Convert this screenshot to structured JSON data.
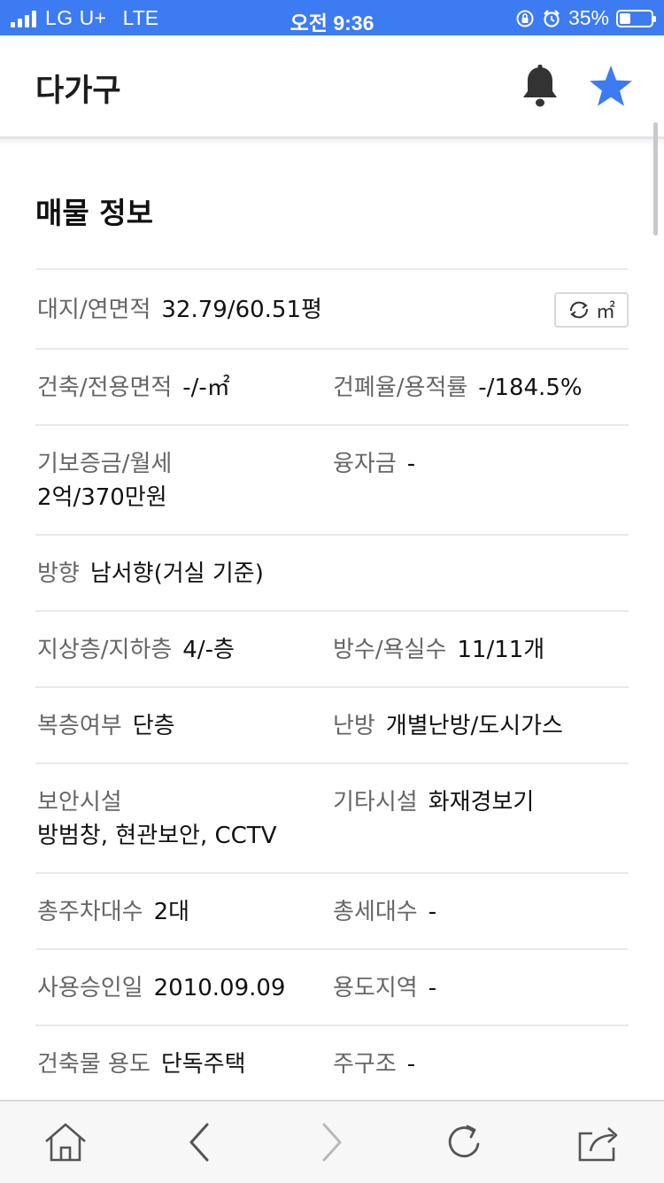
{
  "status_bar": {
    "carrier": "LG U+",
    "network": "LTE",
    "time": "오전 9:36",
    "battery_percent": "35%",
    "battery_level": 0.35
  },
  "header": {
    "title": "다가구",
    "icons": [
      "bell-icon",
      "star-icon"
    ],
    "star_color": "#3d7bf2",
    "bell_color": "#333333"
  },
  "section": {
    "title": "매물 정보"
  },
  "unit_toggle": {
    "label": "㎡",
    "icon": "refresh-icon"
  },
  "rows": [
    {
      "left": {
        "label": "대지/연면적",
        "value": "32.79/60.51평"
      }
    },
    {
      "left": {
        "label": "건축/전용면적",
        "value": "-/-㎡"
      },
      "right": {
        "label": "건폐율/용적률",
        "value": "-/184.5%"
      }
    },
    {
      "left": {
        "label": "기보증금/월세",
        "value": "2억/370만원"
      },
      "right": {
        "label": "융자금",
        "value": "-"
      }
    },
    {
      "left": {
        "label": "방향",
        "value": "남서향(거실 기준)"
      }
    },
    {
      "left": {
        "label": "지상층/지하층",
        "value": "4/-층"
      },
      "right": {
        "label": "방수/욕실수",
        "value": "11/11개"
      }
    },
    {
      "left": {
        "label": "복층여부",
        "value": "단층"
      },
      "right": {
        "label": "난방",
        "value": "개별난방/도시가스"
      }
    },
    {
      "left": {
        "label": "보안시설",
        "value": "방범창, 현관보안, CCTV"
      },
      "right": {
        "label": "기타시설",
        "value": "화재경보기"
      }
    },
    {
      "left": {
        "label": "총주차대수",
        "value": "2대"
      },
      "right": {
        "label": "총세대수",
        "value": "-"
      }
    },
    {
      "left": {
        "label": "사용승인일",
        "value": "2010.09.09"
      },
      "right": {
        "label": "용도지역",
        "value": "-"
      }
    },
    {
      "left": {
        "label": "건축물 용도",
        "value": "단독주택"
      },
      "right": {
        "label": "주구조",
        "value": "-"
      }
    }
  ],
  "toolbar": {
    "icons": [
      "home-icon",
      "back-icon",
      "forward-icon",
      "reload-icon",
      "share-icon"
    ]
  }
}
